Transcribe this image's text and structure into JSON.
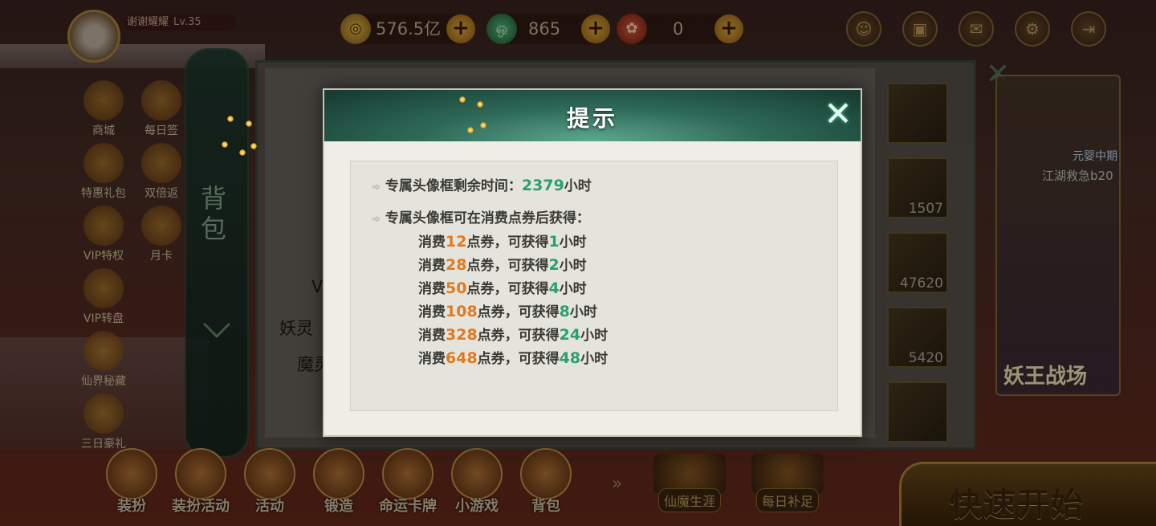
{
  "player": {
    "name": "谢谢耀耀",
    "level": "Lv.35"
  },
  "resources": [
    {
      "icon": "gold-coin-icon",
      "value": "576.5亿"
    },
    {
      "icon": "jade-icon",
      "value": "865"
    },
    {
      "icon": "ticket-icon",
      "value": "0"
    }
  ],
  "left_menu": [
    "商城",
    "每日签",
    "特惠礼包",
    "双倍返",
    "VIP特权",
    "月卡",
    "VIP转盘",
    "仙界秘藏",
    "三日豪礼"
  ],
  "bag_tab": {
    "label": "背包"
  },
  "panel_left_labels": [
    "V",
    "妖灵",
    "魔灵"
  ],
  "grid_counts": [
    "1507",
    "47620",
    "5420"
  ],
  "right_panel": {
    "tag": "元婴中期",
    "line1": "江湖救急b20",
    "line2": "妖王战场"
  },
  "bottom_menu": [
    "装扮",
    "装扮活动",
    "活动",
    "锻造",
    "命运卡牌",
    "小游戏",
    "背包"
  ],
  "bottom_right": [
    "仙魔生涯",
    "每日补足"
  ],
  "quick_start": "快速开始",
  "modal": {
    "title": "提示",
    "remaining_label": "专属头像框剩余时间：",
    "remaining_value": "2379",
    "remaining_unit": "小时",
    "obtain_label": "专属头像框可在消费点券后获得：",
    "tiers": [
      {
        "pre": "消费",
        "spend": "12",
        "mid": "点券，可获得",
        "hours": "1",
        "unit": "小时"
      },
      {
        "pre": "消费",
        "spend": "28",
        "mid": "点券，可获得",
        "hours": "2",
        "unit": "小时"
      },
      {
        "pre": "消费",
        "spend": "50",
        "mid": "点券，可获得",
        "hours": "4",
        "unit": "小时"
      },
      {
        "pre": "消费",
        "spend": "108",
        "mid": "点券，可获得",
        "hours": "8",
        "unit": "小时"
      },
      {
        "pre": "消费",
        "spend": "328",
        "mid": "点券，可获得",
        "hours": "24",
        "unit": "小时"
      },
      {
        "pre": "消费",
        "spend": "648",
        "mid": "点券，可获得",
        "hours": "48",
        "unit": "小时"
      }
    ]
  },
  "colors": {
    "accent_green": "#2aa070",
    "accent_orange": "#e07a20",
    "header_green": "#2e6a58"
  }
}
